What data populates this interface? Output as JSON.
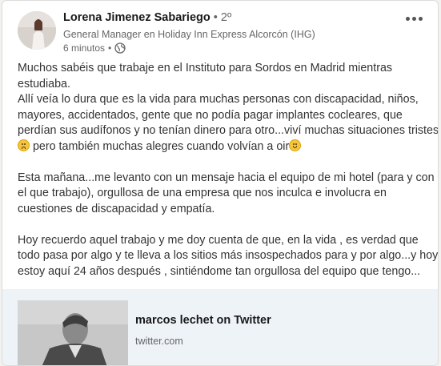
{
  "post": {
    "author": {
      "name": "Lorena Jimenez Sabariego",
      "separator": "•",
      "degree": "2º",
      "headline": "General Manager en Holiday Inn Express Alcorcón (IHG)",
      "time": "6 minutos",
      "time_separator": "•",
      "visibility_icon": "globe-icon"
    },
    "more_icon": "more-options-icon",
    "text": {
      "p1_l1": "Muchos sabéis que trabaje en el Instituto para Sordos en Madrid mientras",
      "p1_l2": "estudiaba.",
      "p1_l3": "Allí veía lo dura que es la vida para muchas personas con discapacidad, niños,",
      "p1_l4": "mayores, accidentados, gente que no podía pagar implantes cocleares, que",
      "p1_l5": "perdían sus audífonos y no tenían dinero para otro...viví muchas situaciones tristes",
      "p1_l6a": " pero también muchas alegres cuando volvían a oir",
      "p2_l1": "Esta mañana...me levanto con un mensaje hacia el equipo de mi hotel (para y con",
      "p2_l2": "el que trabajo), orgullosa de una empresa que nos inculca e involucra en",
      "p2_l3": "cuestiones de discapacidad y empatía.",
      "p3_l1": "Hoy recuerdo aquel trabajo y me doy cuenta de que, en la vida , es verdad que",
      "p3_l2": "todo pasa por algo y te lleva a los sitios más insospechados para y por algo...y hoy",
      "p3_l3": "estoy aquí 24 años después , sintiéndome tan orgullosa del equipo que tengo..."
    },
    "emojis": [
      "sad-face-emoji",
      "smiling-face-emoji"
    ],
    "link_preview": {
      "title": "marcos lechet on Twitter",
      "domain": "twitter.com"
    }
  },
  "colors": {
    "card_bg": "#ffffff",
    "page_bg": "#f3f2ef",
    "link_card_bg": "#eef3f8",
    "secondary_text": "#666666"
  }
}
